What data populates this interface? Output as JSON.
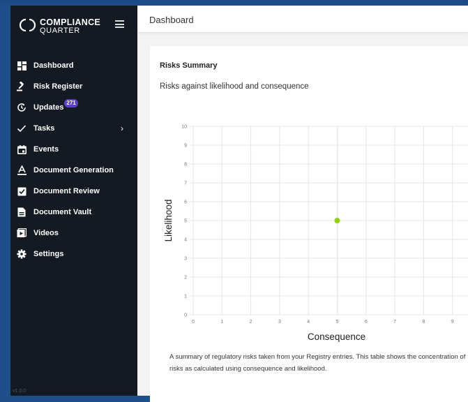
{
  "sidebar": {
    "brand": {
      "line1": "COMPLIANCE",
      "line2": "QUARTER"
    },
    "items": [
      {
        "label": "Dashboard",
        "icon": "dashboard-icon"
      },
      {
        "label": "Risk Register",
        "icon": "gavel-icon"
      },
      {
        "label": "Updates",
        "icon": "history-icon",
        "badge": "271"
      },
      {
        "label": "Tasks",
        "icon": "check-icon"
      },
      {
        "label": "Events",
        "icon": "calendar-icon"
      },
      {
        "label": "Document Generation",
        "icon": "text-format-icon"
      },
      {
        "label": "Document Review",
        "icon": "clipboard-check-icon"
      },
      {
        "label": "Document Vault",
        "icon": "document-icon"
      },
      {
        "label": "Videos",
        "icon": "video-icon"
      },
      {
        "label": "Settings",
        "icon": "gear-icon"
      }
    ],
    "version": "v1.0.0"
  },
  "header": {
    "title": "Dashboard"
  },
  "card": {
    "title": "Risks Summary",
    "subtitle": "Risks against likelihood and consequence",
    "summary": "A summary of regulatory risks taken from your Registry entries. This table shows the concentration of risks as calculated using consequence and likelihood."
  },
  "chart_data": {
    "type": "scatter",
    "xlabel": "Consequence",
    "ylabel": "Likelihood",
    "xlim": [
      0,
      10
    ],
    "ylim": [
      0,
      10
    ],
    "xticks": [
      0,
      1,
      2,
      3,
      4,
      5,
      6,
      7,
      8,
      9
    ],
    "yticks": [
      0,
      1,
      2,
      3,
      4,
      5,
      6,
      7,
      8,
      9,
      10
    ],
    "grid": true,
    "points": [
      {
        "x": 5,
        "y": 5
      }
    ],
    "point_color": "#8fd11a"
  },
  "colors": {
    "sidebar_bg": "#141a22",
    "frame": "#1f4f8a",
    "badge": "#5b3fc9"
  }
}
